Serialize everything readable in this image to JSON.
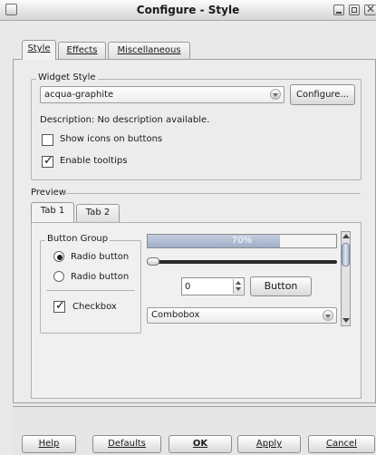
{
  "window": {
    "title": "Configure - Style"
  },
  "tabs": [
    {
      "label": "Style",
      "active": true
    },
    {
      "label": "Effects",
      "active": false
    },
    {
      "label": "Miscellaneous",
      "active": false
    }
  ],
  "widget_style": {
    "group_label": "Widget Style",
    "selected": "acqua-graphite",
    "configure_label": "Configure...",
    "description": "Description: No description available.",
    "show_icons": {
      "label": "Show icons on buttons",
      "checked": false
    },
    "enable_tooltips": {
      "label": "Enable tooltips",
      "checked": true
    }
  },
  "preview": {
    "label": "Preview",
    "tabs": [
      {
        "label": "Tab 1",
        "active": true
      },
      {
        "label": "Tab 2",
        "active": false
      }
    ],
    "button_group": {
      "label": "Button Group",
      "radio1": {
        "label": "Radio button",
        "selected": true
      },
      "radio2": {
        "label": "Radio button",
        "selected": false
      },
      "checkbox": {
        "label": "Checkbox",
        "checked": true
      }
    },
    "progress": {
      "text": "70%",
      "value": 0.7
    },
    "slider": {
      "value": 0
    },
    "spinbox_value": "0",
    "button_label": "Button",
    "combobox_value": "Combobox"
  },
  "footer": {
    "help": "Help",
    "defaults": "Defaults",
    "ok": "OK",
    "apply": "Apply",
    "cancel": "Cancel"
  }
}
